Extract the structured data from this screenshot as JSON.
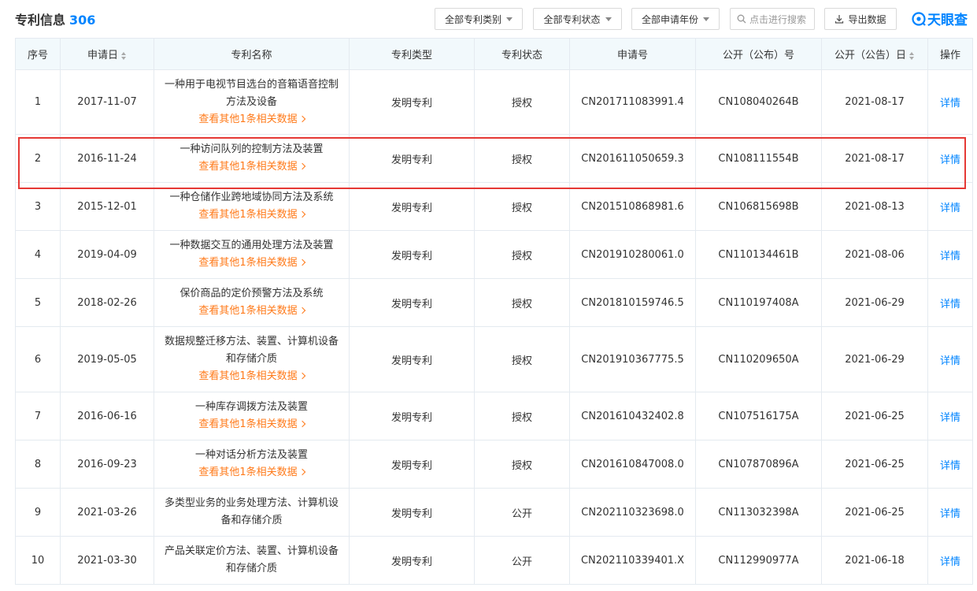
{
  "header": {
    "title": "专利信息",
    "count": "306",
    "filters": [
      {
        "label": "全部专利类别"
      },
      {
        "label": "全部专利状态"
      },
      {
        "label": "全部申请年份"
      }
    ],
    "search_placeholder": "点击进行搜索",
    "export_label": "导出数据",
    "logo_text": "天眼查"
  },
  "table": {
    "columns": [
      "序号",
      "申请日",
      "专利名称",
      "专利类型",
      "专利状态",
      "申请号",
      "公开（公布）号",
      "公开（公告）日",
      "操作"
    ],
    "related_label": "查看其他1条相关数据",
    "detail_label": "详情",
    "rows": [
      {
        "no": "1",
        "date": "2017-11-07",
        "name": "一种用于电视节目选台的音箱语音控制方法及设备",
        "type": "发明专利",
        "status": "授权",
        "app_no": "CN201711083991.4",
        "pub_no": "CN108040264B",
        "pub_date": "2021-08-17"
      },
      {
        "no": "2",
        "date": "2016-11-24",
        "name": "一种访问队列的控制方法及装置",
        "type": "发明专利",
        "status": "授权",
        "app_no": "CN201611050659.3",
        "pub_no": "CN108111554B",
        "pub_date": "2021-08-17"
      },
      {
        "no": "3",
        "date": "2015-12-01",
        "name": "一种仓储作业跨地域协同方法及系统",
        "type": "发明专利",
        "status": "授权",
        "app_no": "CN201510868981.6",
        "pub_no": "CN106815698B",
        "pub_date": "2021-08-13"
      },
      {
        "no": "4",
        "date": "2019-04-09",
        "name": "一种数据交互的通用处理方法及装置",
        "type": "发明专利",
        "status": "授权",
        "app_no": "CN201910280061.0",
        "pub_no": "CN110134461B",
        "pub_date": "2021-08-06"
      },
      {
        "no": "5",
        "date": "2018-02-26",
        "name": "保价商品的定价预警方法及系统",
        "type": "发明专利",
        "status": "授权",
        "app_no": "CN201810159746.5",
        "pub_no": "CN110197408A",
        "pub_date": "2021-06-29"
      },
      {
        "no": "6",
        "date": "2019-05-05",
        "name": "数据规整迁移方法、装置、计算机设备和存储介质",
        "type": "发明专利",
        "status": "授权",
        "app_no": "CN201910367775.5",
        "pub_no": "CN110209650A",
        "pub_date": "2021-06-29"
      },
      {
        "no": "7",
        "date": "2016-06-16",
        "name": "一种库存调拨方法及装置",
        "type": "发明专利",
        "status": "授权",
        "app_no": "CN201610432402.8",
        "pub_no": "CN107516175A",
        "pub_date": "2021-06-25"
      },
      {
        "no": "8",
        "date": "2016-09-23",
        "name": "一种对话分析方法及装置",
        "type": "发明专利",
        "status": "授权",
        "app_no": "CN201610847008.0",
        "pub_no": "CN107870896A",
        "pub_date": "2021-06-25"
      },
      {
        "no": "9",
        "date": "2021-03-26",
        "name": "多类型业务的业务处理方法、计算机设备和存储介质",
        "type": "发明专利",
        "status": "公开",
        "app_no": "CN202110323698.0",
        "pub_no": "CN113032398A",
        "pub_date": "2021-06-25"
      },
      {
        "no": "10",
        "date": "2021-03-30",
        "name": "产品关联定价方法、装置、计算机设备和存储介质",
        "type": "发明专利",
        "status": "公开",
        "app_no": "CN202110339401.X",
        "pub_no": "CN112990977A",
        "pub_date": "2021-06-18"
      }
    ]
  },
  "colors": {
    "accent": "#0084ff",
    "related_link": "#ff7a1a",
    "status_granted": "#2fa64f",
    "status_public": "#a86bd6",
    "highlight": "#e53935",
    "header_bg": "#f2f9fc"
  },
  "highlighted_row": "2"
}
